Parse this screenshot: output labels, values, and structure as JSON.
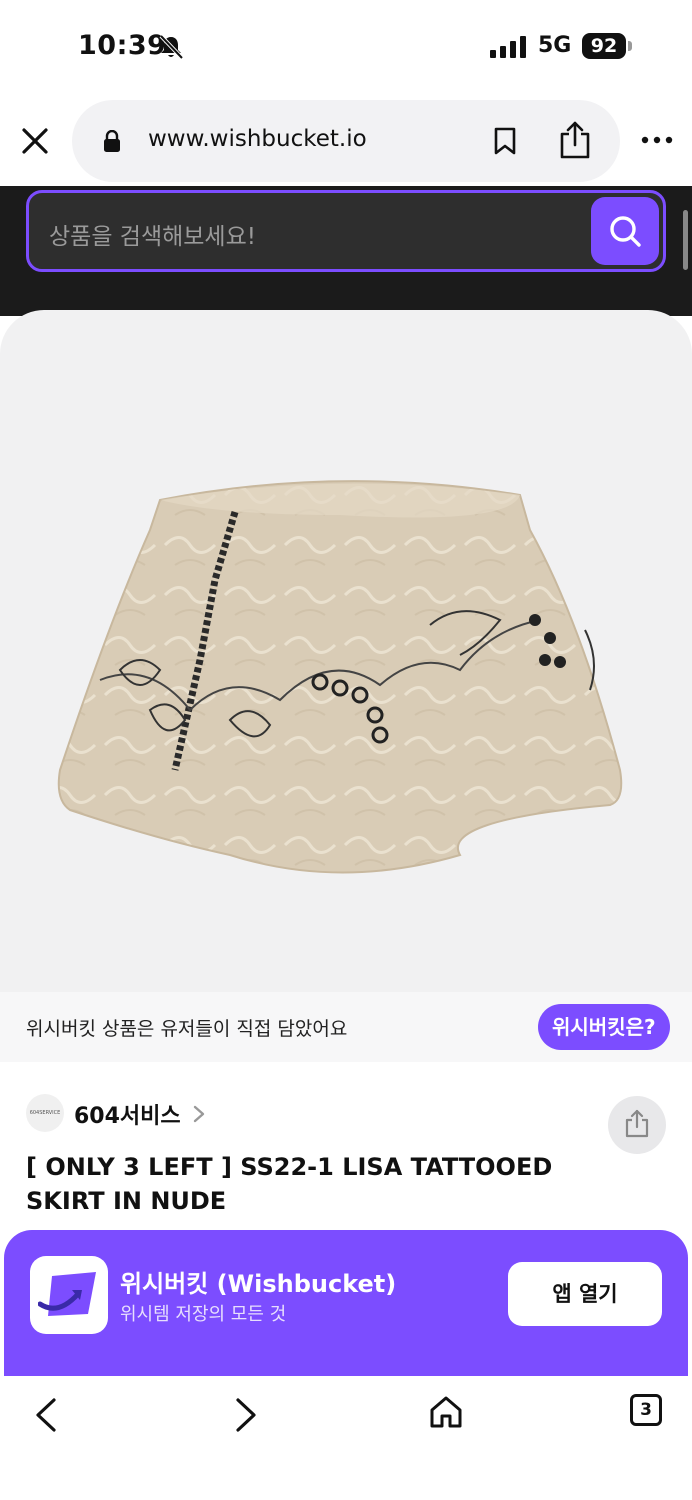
{
  "status_bar": {
    "time": "10:39",
    "network": "5G",
    "battery": "92"
  },
  "browser": {
    "url": "www.wishbucket.io"
  },
  "search": {
    "placeholder": "상품을 검색해보세요!"
  },
  "info_strip": {
    "text": "위시버킷 상품은 유저들이 직접 담았어요",
    "badge": "위시버킷은?"
  },
  "product": {
    "seller_name": "604서비스",
    "seller_logo_text": "604SERVICE",
    "title": "[ ONLY 3 LEFT ] SS22-1 LISA TATTOOED SKIRT IN NUDE"
  },
  "app_banner": {
    "name": "위시버킷 (Wishbucket)",
    "subtitle": "위시템 저장의 모든 것",
    "open_label": "앱 열기"
  },
  "toolbar": {
    "tab_count": "3"
  },
  "colors": {
    "accent": "#7c4dff",
    "dark_header": "#1b1b1b",
    "image_bg": "#f1f1f2"
  },
  "icons": [
    "bell-slash-icon",
    "signal-icon",
    "lock-icon",
    "bookmark-icon",
    "share-icon",
    "more-icon",
    "close-icon",
    "search-icon",
    "chevron-right-icon",
    "back-icon",
    "forward-icon",
    "home-icon",
    "tabs-icon"
  ]
}
